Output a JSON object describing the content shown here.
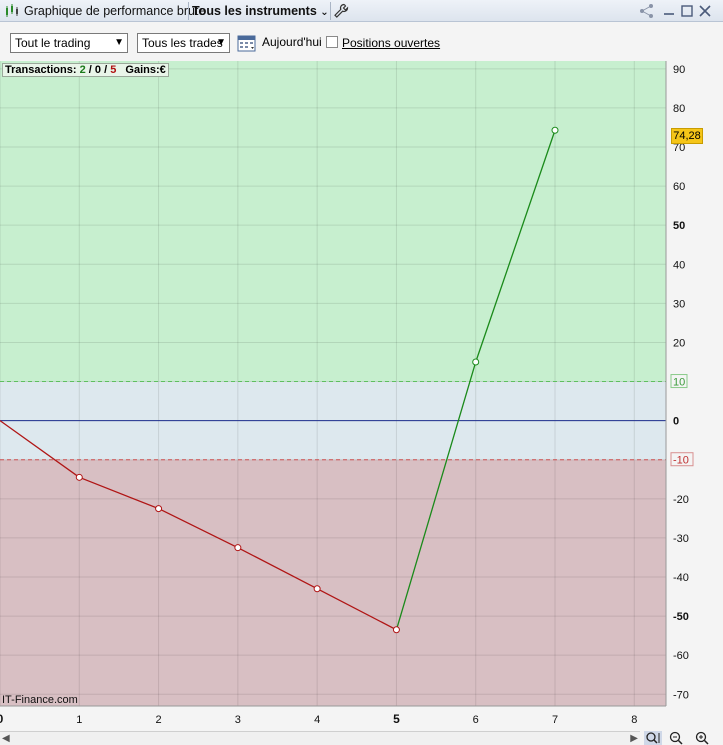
{
  "window": {
    "tabs": [
      {
        "label": "Graphique de performance brute"
      },
      {
        "label": "Tous les instruments"
      }
    ]
  },
  "toolbar": {
    "trading_select": "Tout le trading",
    "trades_select": "Tous les trades",
    "today_label": "Aujourd'hui",
    "open_positions_label": "Positions ouvertes"
  },
  "info": {
    "prefix": "Transactions:",
    "wins": "2",
    "zero": "0",
    "losses": "5",
    "gains_label": "Gains:",
    "currency": "€"
  },
  "watermark": "IT-Finance.com",
  "last_value_label": "74,28",
  "colors": {
    "profit_zone": "#c7efcf",
    "neutral_zone": "#dde8ee",
    "loss_zone": "#d8bfc3",
    "up_line": "#1a8a1a",
    "down_line": "#b01515",
    "zero_line": "#1f2f8f",
    "last_value_badge": "#f5c518"
  },
  "chart_data": {
    "type": "line",
    "x": [
      0,
      1,
      2,
      3,
      4,
      5,
      6,
      7
    ],
    "values": [
      0,
      -14.5,
      -22.5,
      -32.5,
      -43,
      -53.5,
      15,
      74.28
    ],
    "xlim": [
      0,
      8.4
    ],
    "ylim": [
      -73,
      92
    ],
    "x_ticks": [
      0,
      1,
      2,
      3,
      4,
      5,
      6,
      7,
      8
    ],
    "y_ticks": [
      90,
      80,
      70,
      60,
      50,
      40,
      30,
      20,
      10,
      0,
      -10,
      -20,
      -30,
      -40,
      -50,
      -60,
      -70
    ],
    "bold_x_ticks": [
      0,
      5
    ],
    "bold_y_ticks": [
      50,
      0,
      -50
    ],
    "thresholds": {
      "upper": 10,
      "lower": -10
    },
    "grid": true
  }
}
